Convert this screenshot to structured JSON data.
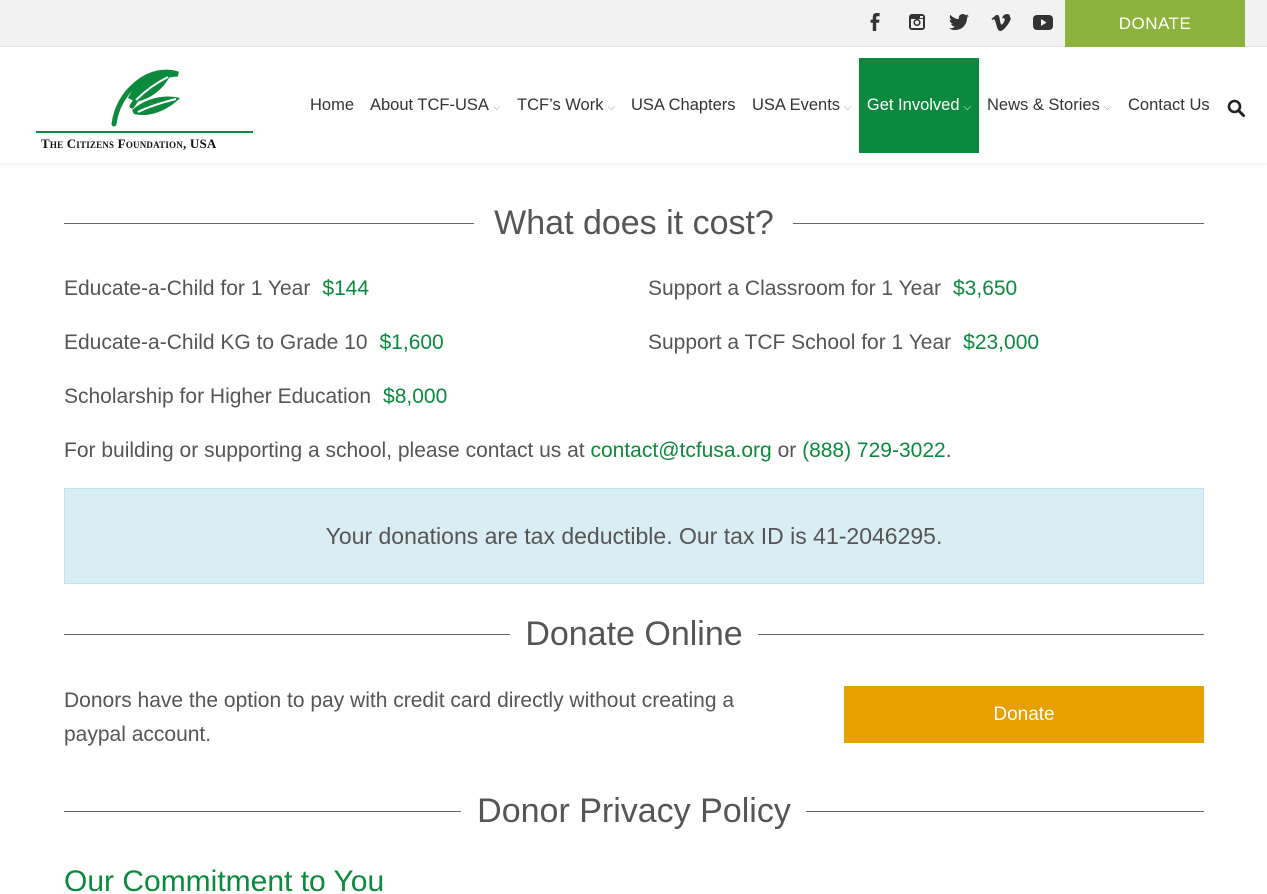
{
  "topbar": {
    "social": [
      "facebook-icon",
      "instagram-icon",
      "twitter-icon",
      "vimeo-icon",
      "youtube-icon"
    ],
    "donate_label": "DONATE"
  },
  "header": {
    "logo_text": "The Citizens Foundation, USA",
    "nav": [
      {
        "label": "Home",
        "dropdown": false
      },
      {
        "label": "About TCF-USA",
        "dropdown": true
      },
      {
        "label": "TCF’s Work",
        "dropdown": true
      },
      {
        "label": "USA Chapters",
        "dropdown": false
      },
      {
        "label": "USA Events",
        "dropdown": true
      },
      {
        "label": "Get Involved",
        "dropdown": true,
        "active": true
      },
      {
        "label": "News & Stories",
        "dropdown": true
      },
      {
        "label": "Contact Us",
        "dropdown": false
      }
    ]
  },
  "cost": {
    "heading": "What does it cost?",
    "items": [
      {
        "label": "Educate-a-Child for 1 Year",
        "value": "$144"
      },
      {
        "label": "Educate-a-Child KG to Grade 10",
        "value": "$1,600"
      },
      {
        "label": "Scholarship for Higher Education",
        "value": "$8,000"
      },
      {
        "label": "Support a Classroom for 1 Year",
        "value": "$3,650"
      },
      {
        "label": "Support a TCF School for 1 Year",
        "value": "$23,000"
      }
    ],
    "contact_prefix": "For building or supporting a school, please contact us at ",
    "contact_email": "contact@tcfusa.org",
    "contact_or": " or ",
    "contact_phone": "(888) 729-3022",
    "contact_suffix": "."
  },
  "notice": "Your donations are tax deductible. Our tax ID is 41-2046295.",
  "donate_online": {
    "heading": "Donate Online",
    "description": "Donors have the option to pay with credit card directly without creating a paypal account.",
    "button_label": "Donate"
  },
  "privacy": {
    "heading": "Donor Privacy Policy",
    "subheading": "Our Commitment to You"
  },
  "colors": {
    "brand_green": "#0b8a3e",
    "donate_top": "#8db33f",
    "donate_button": "#e89f00",
    "notice_bg": "#d9edf4"
  }
}
